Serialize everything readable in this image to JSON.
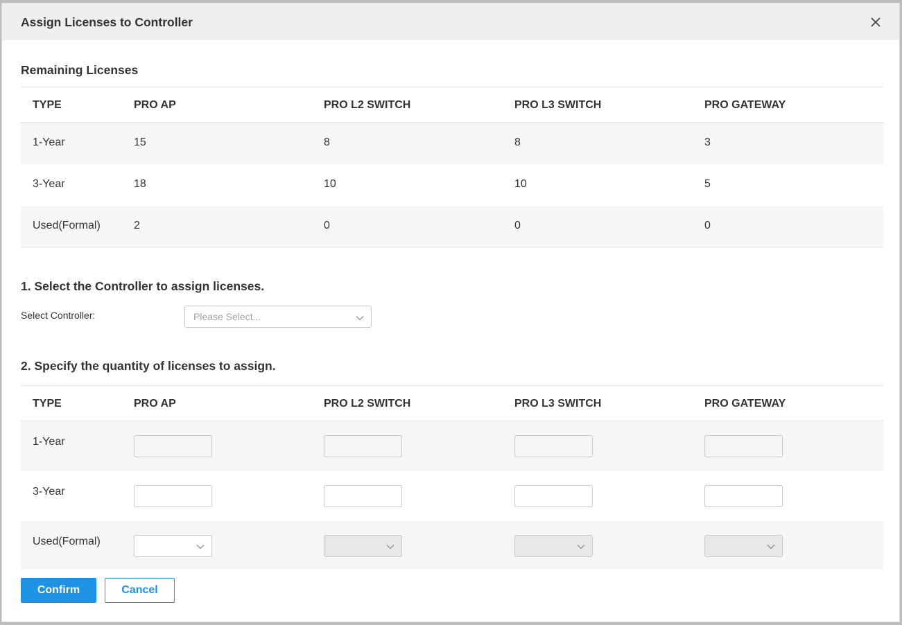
{
  "dialog": {
    "title": "Assign Licenses to Controller",
    "close_icon": "close-icon"
  },
  "remaining": {
    "title": "Remaining Licenses",
    "headers": [
      "TYPE",
      "PRO AP",
      "PRO L2 SWITCH",
      "PRO L3 SWITCH",
      "PRO GATEWAY"
    ],
    "rows": [
      [
        "1-Year",
        "15",
        "8",
        "8",
        "3"
      ],
      [
        "3-Year",
        "18",
        "10",
        "10",
        "5"
      ],
      [
        "Used(Formal)",
        "2",
        "0",
        "0",
        "0"
      ]
    ]
  },
  "step1": {
    "title": "1. Select the Controller to assign licenses.",
    "label": "Select Controller:",
    "placeholder": "Please Select..."
  },
  "step2": {
    "title": "2. Specify the quantity of licenses to assign.",
    "headers": [
      "TYPE",
      "PRO AP",
      "PRO L2 SWITCH",
      "PRO L3 SWITCH",
      "PRO GATEWAY"
    ],
    "row_labels": [
      "1-Year",
      "3-Year",
      "Used(Formal)"
    ]
  },
  "buttons": {
    "confirm": "Confirm",
    "cancel": "Cancel"
  },
  "colors": {
    "accent": "#1e93e6",
    "header_bg": "#eeeff1",
    "row_shade": "#f5f6f7"
  }
}
